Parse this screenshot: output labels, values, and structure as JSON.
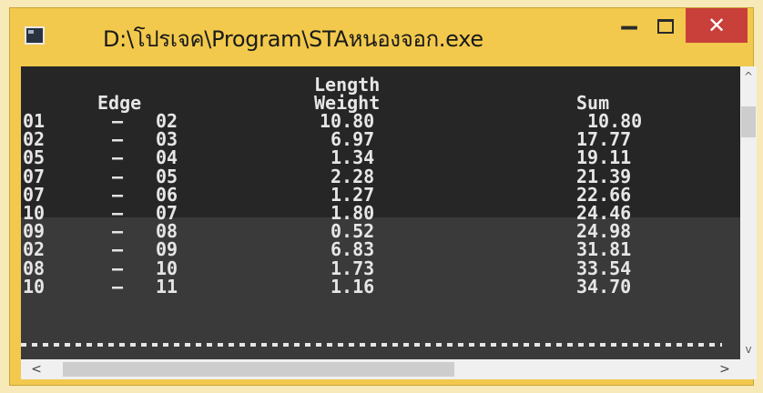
{
  "window": {
    "title": "D:\\โปรเจค\\Program\\STAหนองจอก.exe",
    "minimize_glyph": "‒",
    "close_glyph": "✕"
  },
  "console": {
    "header_length": "Length",
    "header_edge": "Edge",
    "header_weight": "Weight",
    "header_sum": "Sum",
    "rows": [
      {
        "from": "01",
        "dash": "—",
        "to": "02",
        "weight": "10.80",
        "sum": "10.80"
      },
      {
        "from": "02",
        "dash": "—",
        "to": "03",
        "weight": "6.97",
        "sum": "17.77"
      },
      {
        "from": "05",
        "dash": "—",
        "to": "04",
        "weight": "1.34",
        "sum": "19.11"
      },
      {
        "from": "07",
        "dash": "—",
        "to": "05",
        "weight": "2.28",
        "sum": "21.39"
      },
      {
        "from": "07",
        "dash": "—",
        "to": "06",
        "weight": "1.27",
        "sum": "22.66"
      },
      {
        "from": "10",
        "dash": "—",
        "to": "07",
        "weight": "1.80",
        "sum": "24.46"
      },
      {
        "from": "09",
        "dash": "—",
        "to": "08",
        "weight": "0.52",
        "sum": "24.98"
      },
      {
        "from": "02",
        "dash": "—",
        "to": "09",
        "weight": "6.83",
        "sum": "31.81"
      },
      {
        "from": "08",
        "dash": "—",
        "to": "10",
        "weight": "1.73",
        "sum": "33.54"
      },
      {
        "from": "10",
        "dash": "—",
        "to": "11",
        "weight": "1.16",
        "sum": "34.70"
      }
    ]
  },
  "scrollbars": {
    "up_glyph": "^",
    "down_glyph": "v",
    "left_glyph": "<",
    "right_glyph": ">"
  },
  "colors": {
    "titlebar": "#f2c94c",
    "console_bg": "#262626",
    "close_button": "#c9403a"
  },
  "icons": {
    "app": "console-app-icon",
    "minimize": "minimize-icon",
    "maximize": "maximize-icon",
    "close": "close-icon"
  }
}
